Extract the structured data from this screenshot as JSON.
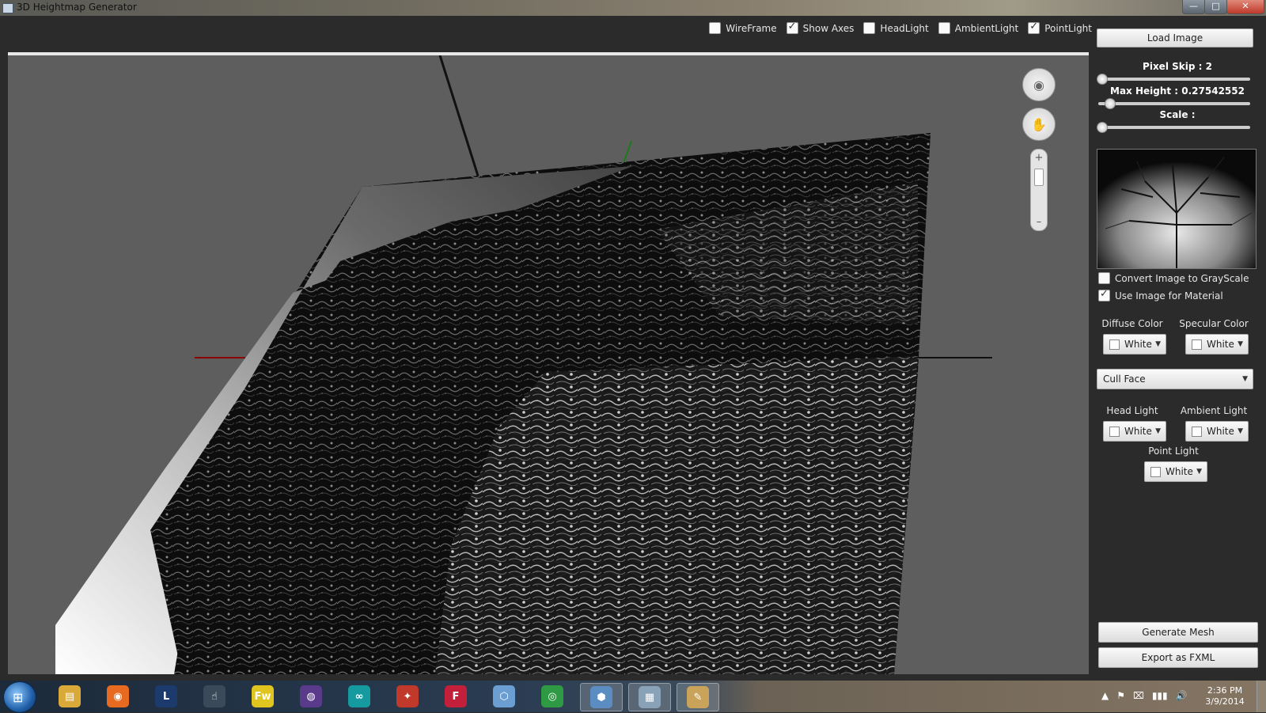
{
  "window": {
    "title": "3D Heightmap Generator",
    "minimize": "—",
    "maximize": "□",
    "close": "✕"
  },
  "toolbar": {
    "checks": [
      {
        "label": "WireFrame",
        "checked": false
      },
      {
        "label": "Show Axes",
        "checked": true
      },
      {
        "label": "HeadLight",
        "checked": false
      },
      {
        "label": "AmbientLight",
        "checked": false
      },
      {
        "label": "PointLight",
        "checked": true
      }
    ]
  },
  "viewport": {
    "nav_rotate_icon": "eye-rotate-icon",
    "nav_pan_icon": "hand-pan-icon",
    "zoom_plus": "+",
    "zoom_minus": "–",
    "axes_colors": {
      "x": "#8b0000",
      "y": "#111111",
      "z": "#1c7a1c"
    }
  },
  "panel": {
    "load_image": "Load Image",
    "pixel_skip_label": "Pixel Skip : 2",
    "pixel_skip_level": 0.0,
    "max_height_label": "Max Height : 0.27542552",
    "max_height_level": 0.05,
    "scale_label": "Scale :",
    "scale_level": 0.0,
    "convert_gray": {
      "label": "Convert Image to GrayScale",
      "checked": false
    },
    "use_material": {
      "label": "Use Image for Material",
      "checked": true
    },
    "diffuse_color": {
      "label": "Diffuse Color",
      "value": "White"
    },
    "specular_color": {
      "label": "Specular Color",
      "value": "White"
    },
    "cull_face": "Cull Face",
    "head_light": {
      "label": "Head Light",
      "value": "White"
    },
    "ambient_light": {
      "label": "Ambient Light",
      "value": "White"
    },
    "point_light": {
      "label": "Point Light",
      "value": "White"
    },
    "generate_mesh": "Generate Mesh",
    "export_fxml": "Export as FXML"
  },
  "taskbar": {
    "apps": [
      {
        "name": "explorer",
        "glyph": "▤",
        "color": "#d9a93a"
      },
      {
        "name": "firefox",
        "glyph": "◉",
        "color": "#e66a1f"
      },
      {
        "name": "league",
        "glyph": "L",
        "color": "#1c3a6b"
      },
      {
        "name": "pointer",
        "glyph": "☝",
        "color": "#3a4a5a"
      },
      {
        "name": "fireworks",
        "glyph": "Fw",
        "color": "#e0c520"
      },
      {
        "name": "eclipse",
        "glyph": "◍",
        "color": "#5a3a8a"
      },
      {
        "name": "arduino",
        "glyph": "∞",
        "color": "#159aa0"
      },
      {
        "name": "flash-red",
        "glyph": "✦",
        "color": "#c0392b"
      },
      {
        "name": "flash",
        "glyph": "F",
        "color": "#c21f3a"
      },
      {
        "name": "cube",
        "glyph": "⬡",
        "color": "#6b9fd4"
      },
      {
        "name": "chrome",
        "glyph": "◎",
        "color": "#2f9a44"
      },
      {
        "name": "java-cube",
        "glyph": "⬢",
        "color": "#5b8dc2"
      },
      {
        "name": "document",
        "glyph": "▦",
        "color": "#8aa2b8"
      },
      {
        "name": "paint",
        "glyph": "✎",
        "color": "#c9a35a"
      }
    ],
    "tray": [
      "▲",
      "⚑",
      "⌧",
      "▮▮▮",
      "🔊"
    ],
    "time": "2:36 PM",
    "date": "3/9/2014"
  }
}
